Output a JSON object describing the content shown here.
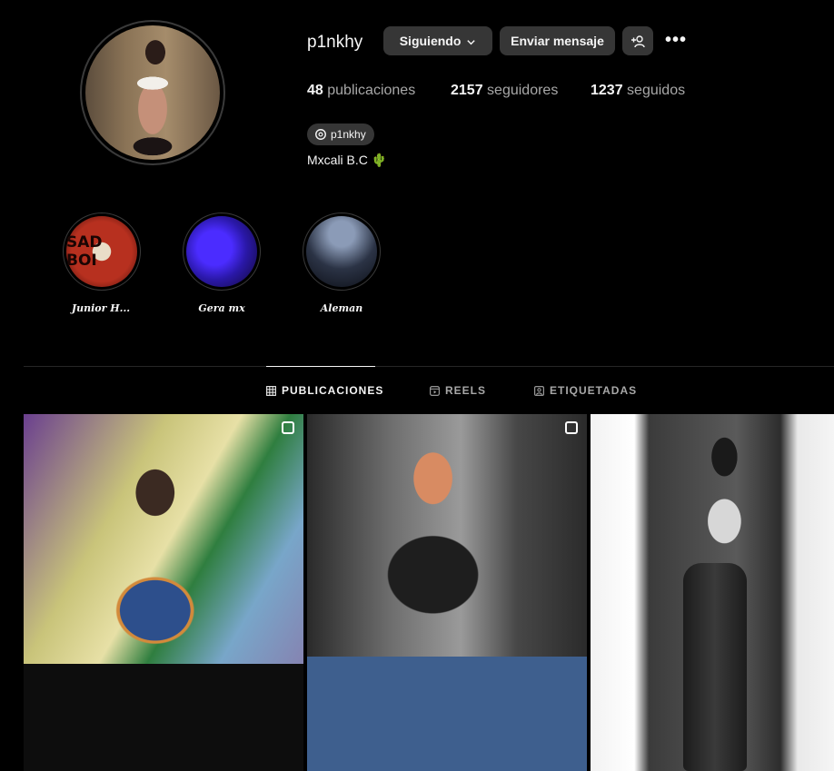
{
  "profile": {
    "username": "p1nkhy",
    "buttons": {
      "following": "Siguiendo",
      "message": "Enviar mensaje",
      "add_user_icon": "add-user-icon",
      "more_icon": "more-options-icon"
    },
    "stats": {
      "posts_count": "48",
      "posts_label": "publicaciones",
      "followers_count": "2157",
      "followers_label": "seguidores",
      "following_count": "1237",
      "following_label": "seguidos"
    },
    "threads_handle": "p1nkhy",
    "bio_location": "Mxcali B.C 🌵"
  },
  "highlights": [
    {
      "label": "Junior H...",
      "image_text": "SAD BOI"
    },
    {
      "label": "Gera mx"
    },
    {
      "label": "Aleman"
    }
  ],
  "tabs": [
    {
      "label": "PUBLICACIONES",
      "icon": "grid-icon",
      "active": true
    },
    {
      "label": "REELS",
      "icon": "reels-icon",
      "active": false
    },
    {
      "label": "ETIQUETADAS",
      "icon": "tagged-icon",
      "active": false
    }
  ],
  "colors": {
    "background": "#000000",
    "button": "#363636",
    "text_primary": "#f5f5f5",
    "text_secondary": "#a8a8a8",
    "divider": "#262626"
  }
}
